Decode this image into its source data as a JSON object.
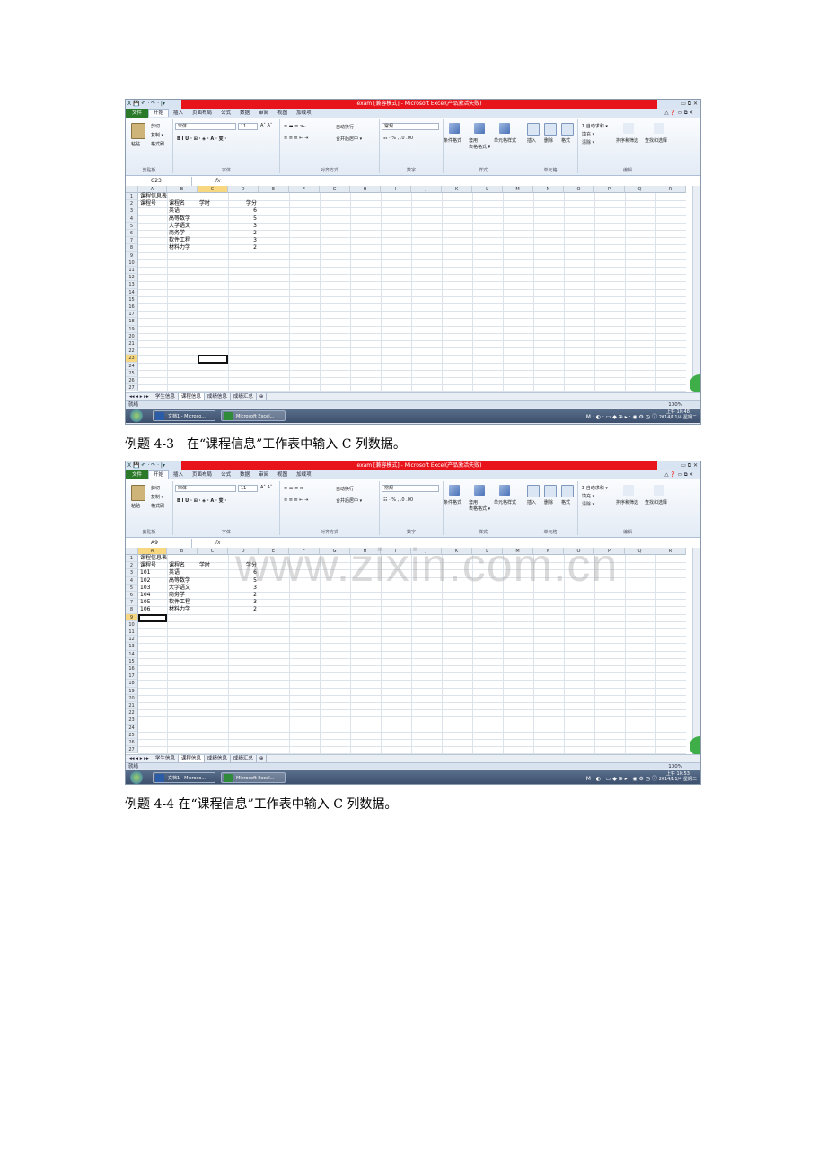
{
  "screenshots": [
    {
      "title": "exam  [兼容模式] - Microsoft Excel(产品激活失败)",
      "quick_access": "X 💾 ↶ · ↷ · |▾",
      "tabs": [
        "文件",
        "开始",
        "插入",
        "页面布局",
        "公式",
        "数据",
        "审阅",
        "视图",
        "加载项"
      ],
      "active_tab": "开始",
      "ribbon": {
        "clipboard": {
          "paste": "粘贴",
          "cut": "剪切",
          "copy": "复制 ▾",
          "format_painter": "格式刷",
          "label": "剪贴板"
        },
        "font": {
          "name": "宋体",
          "size": "11",
          "label": "字体"
        },
        "alignment": {
          "wrap": "自动换行",
          "merge": "合并后居中 ▾",
          "label": "对齐方式"
        },
        "number": {
          "format": "常规",
          "label": "数字"
        },
        "styles": {
          "cond": "条件格式",
          "table": "套用\n表格格式 ▾",
          "cell": "单元格样式",
          "label": "样式"
        },
        "cells": {
          "insert": "插入",
          "delete": "删除",
          "format": "格式",
          "label": "单元格"
        },
        "editing": {
          "autosum": "Σ 自动求和 ▾",
          "fill": "填充 ▾",
          "clear": "清除 ▾",
          "sort": "排序和筛选",
          "find": "查找和选择",
          "label": "编辑"
        }
      },
      "name_box": "C23",
      "fx": "fx",
      "columns": [
        "A",
        "B",
        "C",
        "D",
        "E",
        "F",
        "G",
        "H",
        "I",
        "J",
        "K",
        "L",
        "M",
        "N",
        "O",
        "P",
        "Q",
        "R"
      ],
      "selected_col": "C",
      "selected_row": 23,
      "rows": 27,
      "cells": {
        "A1": "课程信息表",
        "A2": "课程号",
        "B2": "课程名",
        "C2": "学时",
        "D2": "学分",
        "B3": "英语",
        "D3": "6",
        "B4": "高等数学",
        "D4": "5",
        "B5": "大学语文",
        "D5": "3",
        "B6": "商务学",
        "D6": "2",
        "B7": "软件工程",
        "D7": "3",
        "B8": "材料力学",
        "D8": "2"
      },
      "sheet_tabs": [
        "学生信息",
        "课程信息",
        "成绩信息",
        "成绩汇总"
      ],
      "active_sheet": "课程信息",
      "status": "就绪",
      "zoom": "100%",
      "taskbar": {
        "word": "文档1 - Microso...",
        "excel": "Microsoft Excel...",
        "clock_time": "上午 10:48",
        "clock_date": "2014/11/4 星期二"
      }
    },
    {
      "title": "exam  [兼容模式] - Microsoft Excel(产品激活失败)",
      "quick_access": "X 💾 ↶ · ↷ · |▾",
      "tabs": [
        "文件",
        "开始",
        "插入",
        "页面布局",
        "公式",
        "数据",
        "审阅",
        "视图",
        "加载项"
      ],
      "active_tab": "开始",
      "ribbon": {
        "clipboard": {
          "paste": "粘贴",
          "cut": "剪切",
          "copy": "复制 ▾",
          "format_painter": "格式刷",
          "label": "剪贴板"
        },
        "font": {
          "name": "宋体",
          "size": "11",
          "label": "字体"
        },
        "alignment": {
          "wrap": "自动换行",
          "merge": "合并后居中 ▾",
          "label": "对齐方式"
        },
        "number": {
          "format": "常规",
          "label": "数字"
        },
        "styles": {
          "cond": "条件格式",
          "table": "套用\n表格格式 ▾",
          "cell": "单元格样式",
          "label": "样式"
        },
        "cells": {
          "insert": "插入",
          "delete": "删除",
          "format": "格式",
          "label": "单元格"
        },
        "editing": {
          "autosum": "Σ 自动求和 ▾",
          "fill": "填充 ▾",
          "clear": "清除 ▾",
          "sort": "排序和筛选",
          "find": "查找和选择",
          "label": "编辑"
        }
      },
      "name_box": "A9",
      "fx": "fx",
      "columns": [
        "A",
        "B",
        "C",
        "D",
        "E",
        "F",
        "G",
        "H",
        "I",
        "J",
        "K",
        "L",
        "M",
        "N",
        "O",
        "P",
        "Q",
        "R"
      ],
      "selected_col": "A",
      "selected_row": 9,
      "rows": 27,
      "cells": {
        "A1": "课程信息表",
        "A2": "课程号",
        "B2": "课程名",
        "C2": "学时",
        "D2": "学分",
        "A3": "101",
        "B3": "英语",
        "D3": "6",
        "A4": "102",
        "B4": "高等数学",
        "D4": "5",
        "A5": "103",
        "B5": "大学语文",
        "D5": "3",
        "A6": "104",
        "B6": "商务学",
        "D6": "2",
        "A7": "105",
        "B7": "软件工程",
        "D7": "3",
        "A8": "106",
        "B8": "材料力学",
        "D8": "2"
      },
      "sheet_tabs": [
        "学生信息",
        "课程信息",
        "成绩信息",
        "成绩汇总"
      ],
      "active_sheet": "课程信息",
      "status": "就绪",
      "zoom": "100%",
      "taskbar": {
        "word": "文档1 - Microso...",
        "excel": "Microsoft Excel...",
        "clock_time": "上午 10:53",
        "clock_date": "2014/11/4 星期二"
      }
    }
  ],
  "captions": [
    "例题 4-3　在“课程信息”工作表中输入 C 列数据。",
    "例题 4-4  在“课程信息”工作表中输入 C 列数据。"
  ],
  "watermark": "www.zixin.com.cn"
}
